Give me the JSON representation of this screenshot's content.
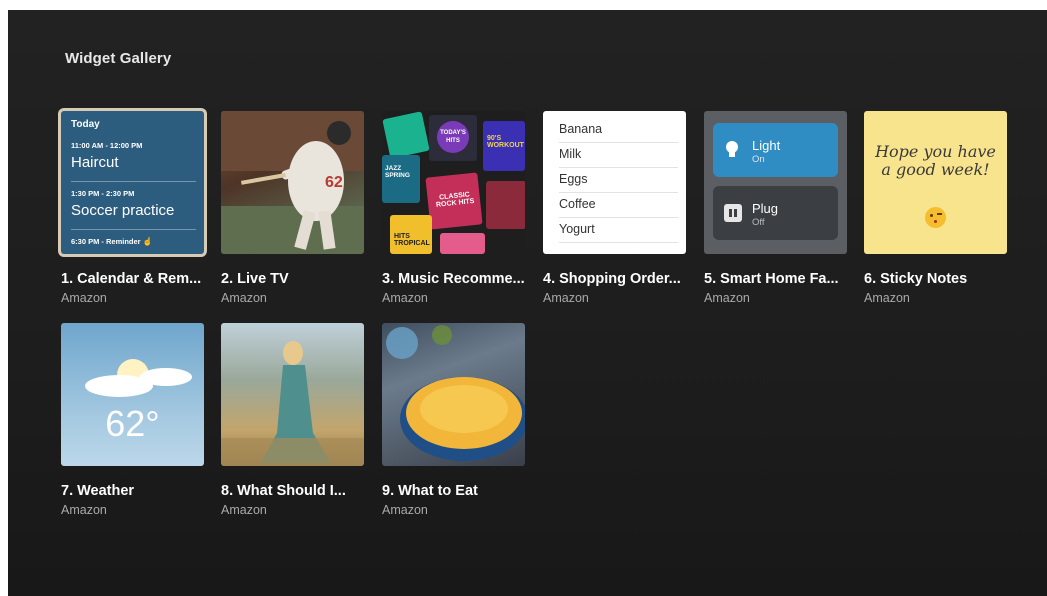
{
  "gallery": {
    "title": "Widget Gallery"
  },
  "widgets": [
    {
      "name": "1. Calendar & Rem...",
      "publisher": "Amazon"
    },
    {
      "name": "2. Live TV",
      "publisher": "Amazon"
    },
    {
      "name": "3. Music Recomme...",
      "publisher": "Amazon"
    },
    {
      "name": "4. Shopping Order...",
      "publisher": "Amazon"
    },
    {
      "name": "5. Smart Home Fa...",
      "publisher": "Amazon"
    },
    {
      "name": "6. Sticky Notes",
      "publisher": "Amazon"
    },
    {
      "name": "7. Weather",
      "publisher": "Amazon"
    },
    {
      "name": "8. What Should I...",
      "publisher": "Amazon"
    },
    {
      "name": "9. What to Eat",
      "publisher": "Amazon"
    }
  ],
  "calendar": {
    "header": "Today",
    "events": [
      {
        "time": "11:00 AM - 12:00 PM",
        "title": "Haircut"
      },
      {
        "time": "1:30 PM - 2:30 PM",
        "title": "Soccer practice"
      }
    ],
    "reminder": "6:30 PM - Reminder"
  },
  "music": {
    "tiles": [
      "TODAY'S HITS",
      "90'S WORKOUT",
      "JAZZ SPRING",
      "CLASSIC ROCK HITS",
      "HITS TROPICAL"
    ]
  },
  "shopping": {
    "items": [
      "Banana",
      "Milk",
      "Eggs",
      "Coffee",
      "Yogurt"
    ]
  },
  "smart_home": {
    "devices": [
      {
        "name": "Light",
        "state": "On",
        "icon": "bulb-icon"
      },
      {
        "name": "Plug",
        "state": "Off",
        "icon": "plug-icon"
      }
    ]
  },
  "sticky": {
    "text": "Hope you have a good week!",
    "emoji": "kissing-face-icon"
  },
  "weather": {
    "temperature": "62°",
    "icon": "partly-cloudy-icon"
  },
  "colors": {
    "background": "#1e1e1e",
    "focus_ring": "#d7cbb6",
    "calendar": "#2d5d7e",
    "smart_home_active": "#2f8dc3",
    "sticky": "#f9e48e"
  }
}
